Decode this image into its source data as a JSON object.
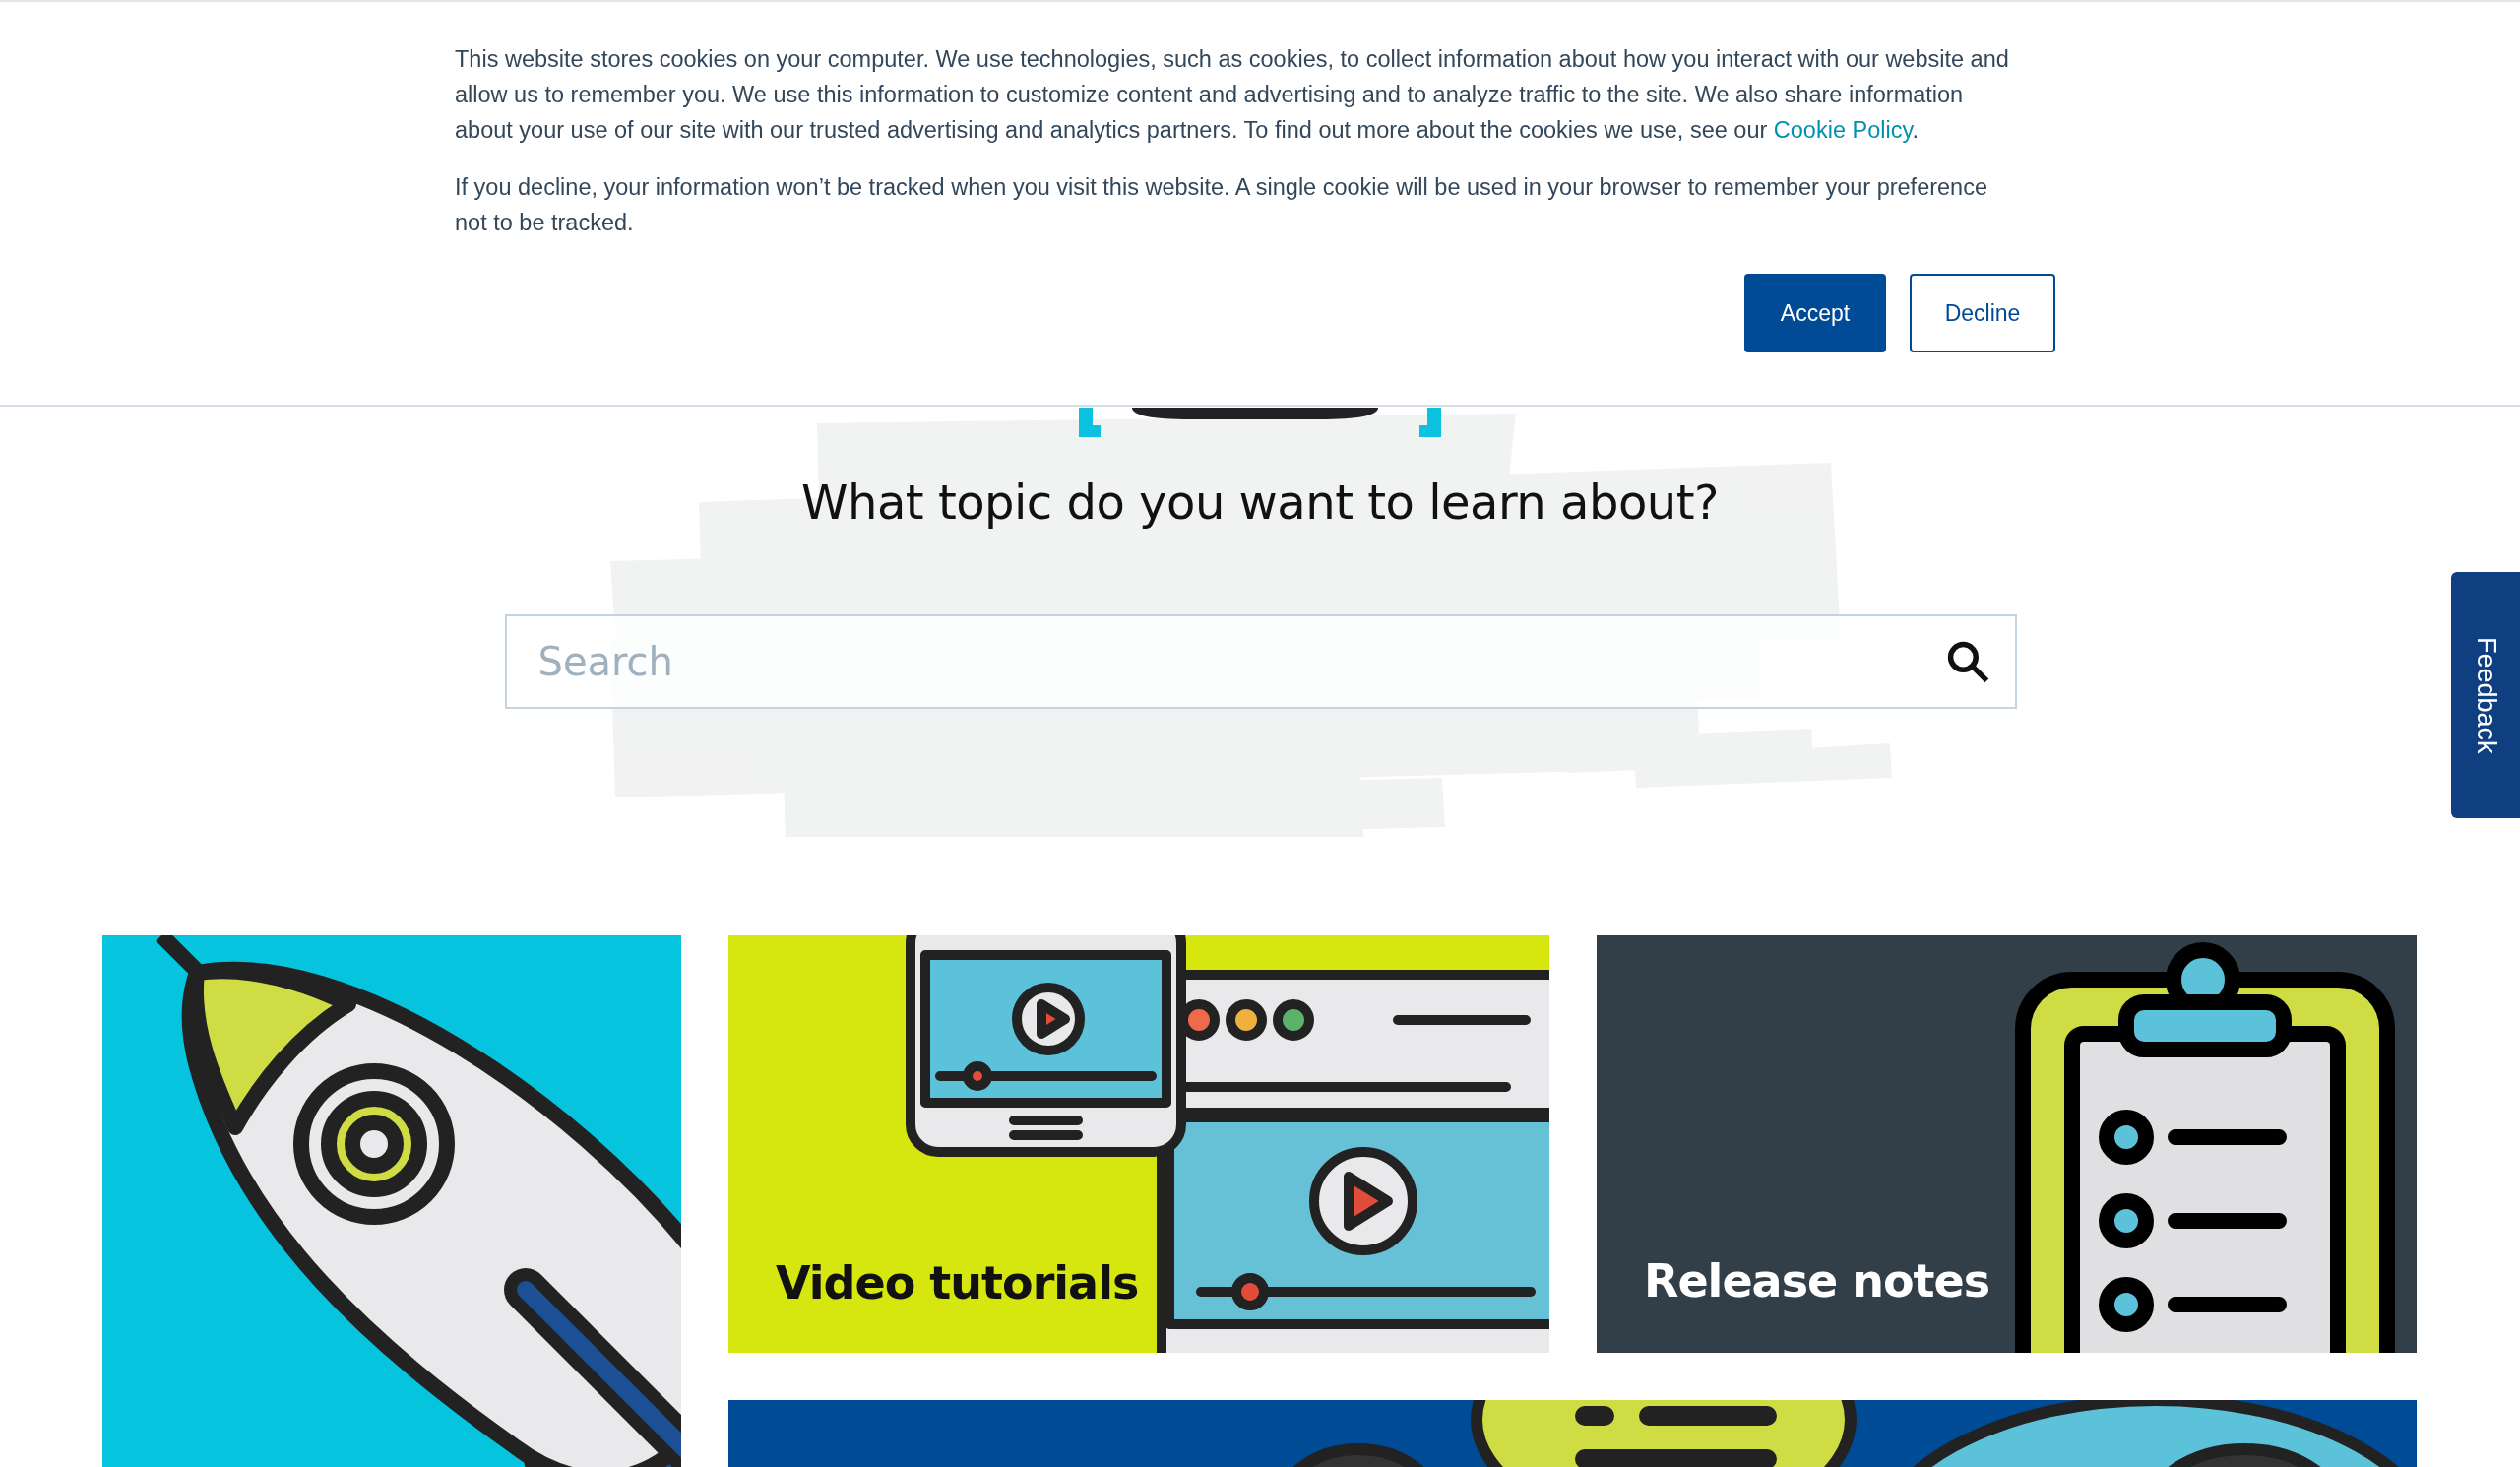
{
  "cookie_banner": {
    "paragraphs": [
      {
        "text": "This website stores cookies on your computer. We use technologies, such as cookies, to collect information about how you interact with our website and allow us to remember you. We use this information to customize content and advertising and to analyze traffic to the site. We also share information about your use of our site with our trusted advertising and analytics partners. To find out more about the cookies we use, see our ",
        "link": "Cookie Policy",
        "after": "."
      },
      {
        "text": "If you decline, your information won’t be tracked when you visit this website. A single cookie will be used in your browser to remember your preference not to be tracked."
      }
    ],
    "buttons": [
      {
        "label": "Accept",
        "kind": "primary"
      },
      {
        "label": "Decline",
        "kind": "secondary"
      }
    ]
  },
  "hero": {
    "heading": "What topic do you want to learn about?",
    "search": {
      "placeholder": "Search"
    }
  },
  "feedback_tab": {
    "label": "Feedback"
  },
  "cards": [
    {
      "kind": "rocket"
    },
    {
      "kind": "video",
      "title": "Video tutorials"
    },
    {
      "kind": "clipboard",
      "title": "Release notes"
    },
    {
      "kind": "chat"
    }
  ]
}
